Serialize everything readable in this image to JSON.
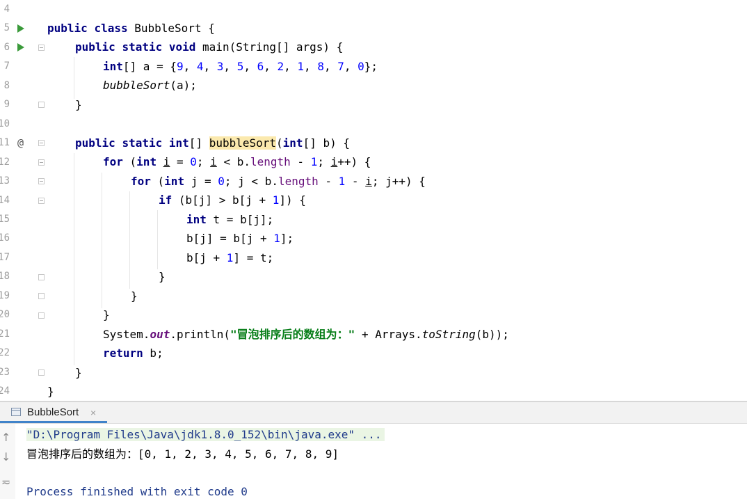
{
  "editor": {
    "line_numbers": [
      "4",
      "5",
      "6",
      "7",
      "8",
      "9",
      "10",
      "11",
      "12",
      "13",
      "14",
      "15",
      "16",
      "17",
      "18",
      "19",
      "20",
      "21",
      "22",
      "23",
      "24"
    ],
    "gutter_marks": {
      "run_lines": [
        "5",
        "6"
      ],
      "override_line": "11",
      "override_symbol": "@"
    },
    "code": {
      "l5": [
        "public",
        " ",
        "class",
        " BubbleSort {"
      ],
      "l6": [
        "public",
        " ",
        "static",
        " ",
        "void",
        " main(String[] args) {"
      ],
      "l7": [
        "int",
        "[] a = {",
        "9",
        ", ",
        "4",
        ", ",
        "3",
        ", ",
        "5",
        ", ",
        "6",
        ", ",
        "2",
        ", ",
        "1",
        ", ",
        "8",
        ", ",
        "7",
        ", ",
        "0",
        "};"
      ],
      "l8": [
        "bubbleSort",
        "(a);"
      ],
      "l9": "}",
      "l11": [
        "public",
        " ",
        "static",
        " ",
        "int",
        "[] ",
        "bubbleSort",
        "(",
        "int",
        "[] b) {"
      ],
      "l12": [
        "for",
        " (",
        "int",
        " ",
        "i",
        " = ",
        "0",
        "; ",
        "i",
        " < b.",
        "length",
        " - ",
        "1",
        "; ",
        "i",
        "++) {"
      ],
      "l13": [
        "for",
        " (",
        "int",
        " j = ",
        "0",
        "; j < b.",
        "length",
        " - ",
        "1",
        " - ",
        "i",
        "; j++) {"
      ],
      "l14": [
        "if",
        " (b[j] > b[j + ",
        "1",
        "]) {"
      ],
      "l15": [
        "int",
        " t = b[j];"
      ],
      "l16": [
        "b[j] = b[j + ",
        "1",
        "];"
      ],
      "l17": [
        "b[j + ",
        "1",
        "] = t;"
      ],
      "l18": "}",
      "l19": "}",
      "l20": "}",
      "l21": [
        "System.",
        "out",
        ".println(",
        "\"冒泡排序后的数组为：\"",
        " + Arrays.",
        "toString",
        "(b));"
      ],
      "l22": [
        "return",
        " b;"
      ],
      "l23": "}",
      "l24": "}"
    }
  },
  "run_panel": {
    "tab_label": "BubbleSort",
    "tab_close": "×",
    "side_icons": {
      "up": "↑",
      "down": "↓",
      "wrap": "≂"
    }
  },
  "console": {
    "command": "\"D:\\Program Files\\Java\\jdk1.8.0_152\\bin\\java.exe\" ...",
    "output": "冒泡排序后的数组为：[0, 1, 2, 3, 4, 5, 6, 7, 8, 9]",
    "exit": "Process finished with exit code 0"
  }
}
